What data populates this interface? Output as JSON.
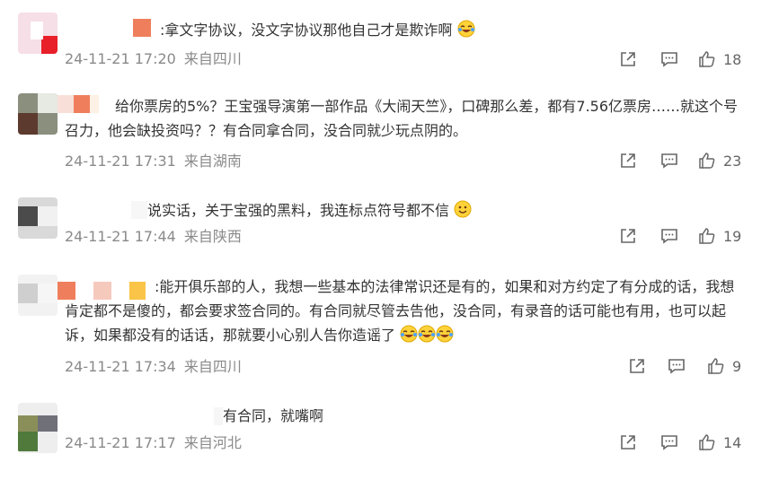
{
  "comments": [
    {
      "text": ":拿文字协议，没文字协议那他自己才是欺诈啊",
      "emojis": [
        "laugh-cry-emoji"
      ],
      "date": "24-11-21 17:20",
      "location": "来自四川",
      "likes": "18"
    },
    {
      "text": "给你票房的5%？王宝强导演第一部作品《大闹天竺》，口碑那么差，都有7.56亿票房……就这个号召力，他会缺投资吗？？有合同拿合同，没合同就少玩点阴的。",
      "emojis": [],
      "date": "24-11-21 17:31",
      "location": "来自湖南",
      "likes": "23"
    },
    {
      "text": "说实话，关于宝强的黑料，我连标点符号都不信",
      "emojis": [
        "smile-emoji"
      ],
      "date": "24-11-21 17:44",
      "location": "来自陕西",
      "likes": "19"
    },
    {
      "text": ":能开俱乐部的人，我想一些基本的法律常识还是有的，如果和对方约定了有分成的话，我想肯定都不是傻的，都会要求签合同的。有合同就尽管去告他，没合同，有录音的话可能也有用，也可以起诉，如果都没有的话话，那就要小心别人告你造谣了",
      "emojis": [
        "laugh-cry-emoji",
        "laugh-cry-emoji",
        "laugh-cry-emoji"
      ],
      "date": "24-11-21 17:34",
      "location": "来自四川",
      "likes": "9"
    },
    {
      "text": "有合同，就嘴啊",
      "emojis": [],
      "date": "24-11-21 17:17",
      "location": "来自河北",
      "likes": "14"
    }
  ],
  "icons": {
    "share": "share-icon",
    "comment": "comment-icon",
    "like": "thumbs-up-icon"
  },
  "colors": {
    "text": "#333333",
    "meta": "#8a8a8a",
    "mosaic_orange": "#ef7f5c"
  }
}
